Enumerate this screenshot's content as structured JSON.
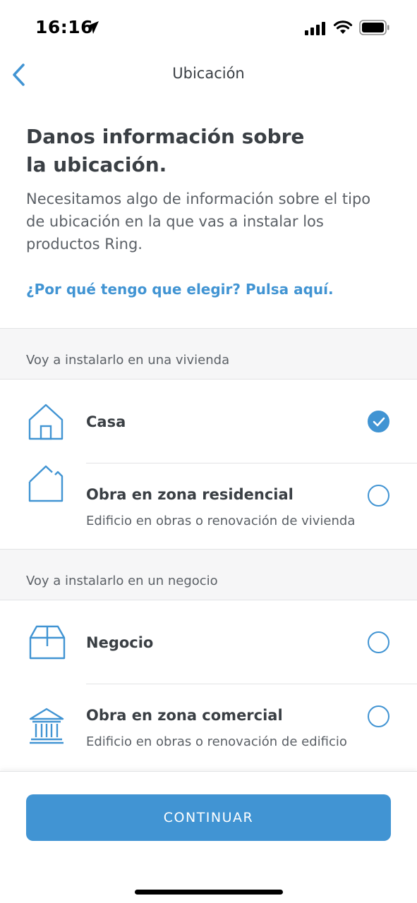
{
  "status_bar": {
    "time": "16:16",
    "icons": [
      "location-arrow-icon",
      "cellular-signal-icon",
      "wifi-icon",
      "battery-icon"
    ]
  },
  "nav": {
    "title": "Ubicación",
    "back_icon": "chevron-left-icon"
  },
  "intro": {
    "heading_line1": "Danos información sobre",
    "heading_line2": "la ubicación.",
    "description_line1": "Necesitamos algo de información sobre el tipo",
    "description_line2": "de ubicación en la que vas a instalar los",
    "description_line3": "productos Ring.",
    "help_link": "¿Por qué tengo que elegir? Pulsa aquí."
  },
  "sections": [
    {
      "header": "Voy a instalarlo en una vivienda",
      "options": [
        {
          "title": "Casa",
          "subtitle": "",
          "icon": "house-icon",
          "selected": true
        },
        {
          "title": "Obra en zona residencial",
          "subtitle": "Edificio en obras o renovación de vivienda",
          "icon": "house-under-construction-icon",
          "selected": false
        }
      ]
    },
    {
      "header": "Voy a instalarlo en un negocio",
      "options": [
        {
          "title": "Negocio",
          "subtitle": "",
          "icon": "shop-box-icon",
          "selected": false
        },
        {
          "title": "Obra en zona comercial",
          "subtitle": "Edificio en obras o renovación de edificio",
          "icon": "bank-building-icon",
          "selected": false
        }
      ]
    }
  ],
  "footer": {
    "continue_label": "CONTINUAR"
  },
  "colors": {
    "accent": "#4194d3",
    "text": "#3a3f44",
    "muted": "#5b6066",
    "section_bg": "#f6f6f7"
  }
}
